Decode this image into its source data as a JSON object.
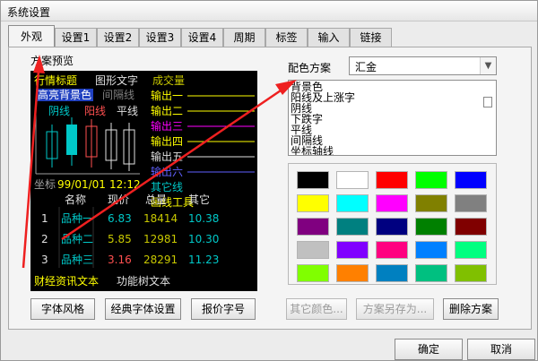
{
  "window": {
    "title": "系统设置"
  },
  "tabs": [
    {
      "label": "外观",
      "active": true
    },
    {
      "label": "设置1",
      "active": false
    },
    {
      "label": "设置2",
      "active": false
    },
    {
      "label": "设置3",
      "active": false
    },
    {
      "label": "设置4",
      "active": false
    },
    {
      "label": "周期",
      "active": false
    },
    {
      "label": "标签",
      "active": false
    },
    {
      "label": "输入",
      "active": false
    },
    {
      "label": "链接",
      "active": false
    }
  ],
  "preview": {
    "label": "方案预览",
    "title_row": {
      "quote_title": "行情标题",
      "graph_text": "图形文字",
      "volume_label": "成交量"
    },
    "highlight_bg": "高亮背景色",
    "gap_line": "间隔线",
    "candle_labels": {
      "yin": "阴线",
      "yang": "阳线",
      "flat": "平线"
    },
    "outputs": [
      "输出一",
      "输出二",
      "输出三",
      "输出四",
      "输出五",
      "输出六"
    ],
    "other_lines": "其它线",
    "draw_tools": "画线工具",
    "axis_row": {
      "label": "坐标",
      "date": "99/01/01",
      "time": "12:12"
    },
    "table": {
      "headers": [
        "名称",
        "现价",
        "总量",
        "其它"
      ],
      "rows": [
        {
          "index": "1",
          "name": "品种一",
          "price": "6.83",
          "volume": "18414",
          "other": "10.38"
        },
        {
          "index": "2",
          "name": "品种二",
          "price": "5.85",
          "volume": "12981",
          "other": "10.30"
        },
        {
          "index": "3",
          "name": "品种三",
          "price": "3.16",
          "volume": "28291",
          "other": "11.23"
        }
      ]
    },
    "footer_left": "财经资讯文本",
    "footer_right": "功能树文本"
  },
  "scheme": {
    "label": "配色方案",
    "value": "汇金"
  },
  "color_items": [
    "背景色",
    "阳线及上涨字",
    "阴线",
    "下跌字",
    "平线",
    "间隔线",
    "坐标轴线"
  ],
  "palette": [
    "#000000",
    "#ffffff",
    "#ff0000",
    "#00ff00",
    "#0000ff",
    "#ffff00",
    "#00ffff",
    "#ff00ff",
    "#808000",
    "#808080",
    "#800080",
    "#008080",
    "#000080",
    "#008000",
    "#800000",
    "#c0c0c0",
    "#8000ff",
    "#ff0080",
    "#0080ff",
    "#00ff80",
    "#80ff00",
    "#ff8000",
    "#0080c0",
    "#00c080",
    "#80c000"
  ],
  "buttons": {
    "font_style": "字体风格",
    "classic_font": "经典字体设置",
    "quote_font": "报价字号",
    "other_color": "其它颜色...",
    "save_scheme_as": "方案另存为...",
    "delete_scheme": "删除方案",
    "ok": "确定",
    "cancel": "取消"
  },
  "colors": {
    "preview_bg": "#000000",
    "title_yellow": "#ffff00",
    "volume_yellow": "#c8c800",
    "highlight_bg": "#2040c0",
    "gray_text": "#a0a0a0",
    "yin_cyan": "#00c8c8",
    "yang_red": "#ff5050",
    "output_magenta": "#ff00ff",
    "output_blue": "#6060ff",
    "arrow_red": "#ee2020"
  }
}
